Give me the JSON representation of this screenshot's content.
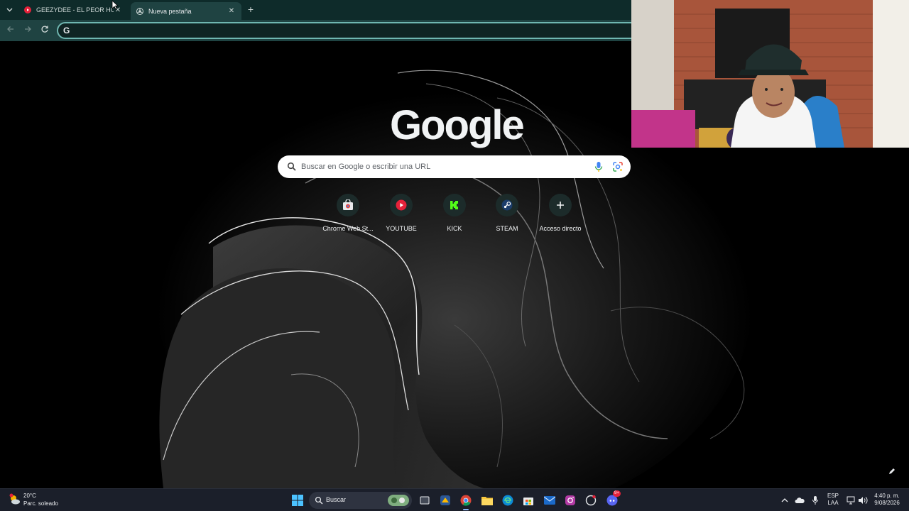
{
  "browser": {
    "tabs": [
      {
        "title": "GEEZYDEE - EL PEOR HOMBRE",
        "favicon": "youtube-icon",
        "active": false
      },
      {
        "title": "Nueva pestaña",
        "favicon": "chrome-icon",
        "active": true
      }
    ],
    "omnibox": {
      "value": ""
    }
  },
  "ntp": {
    "logo": "Google",
    "search_placeholder": "Buscar en Google o escribir una URL",
    "shortcuts": [
      {
        "label": "Chrome Web St...",
        "icon": "chrome-web-store-icon"
      },
      {
        "label": "YOUTUBE",
        "icon": "youtube-icon"
      },
      {
        "label": "KICK",
        "icon": "kick-icon"
      },
      {
        "label": "STEAM",
        "icon": "steam-icon"
      },
      {
        "label": "Acceso directo",
        "icon": "plus-icon"
      }
    ]
  },
  "taskbar": {
    "weather": {
      "temp": "20°C",
      "desc": "Parc. soleado"
    },
    "search_label": "Buscar",
    "language": {
      "line1": "ESP",
      "line2": "LAA"
    },
    "clock": {
      "time": "4:40 p. m.",
      "date": "9/08/2026"
    },
    "discord_badge": "9+"
  },
  "colors": {
    "tabstrip": "#0e2b2a",
    "toolbar": "#1f4342",
    "omnibox_border": "#6fb6b0",
    "taskbar": "#1b1f2a"
  }
}
